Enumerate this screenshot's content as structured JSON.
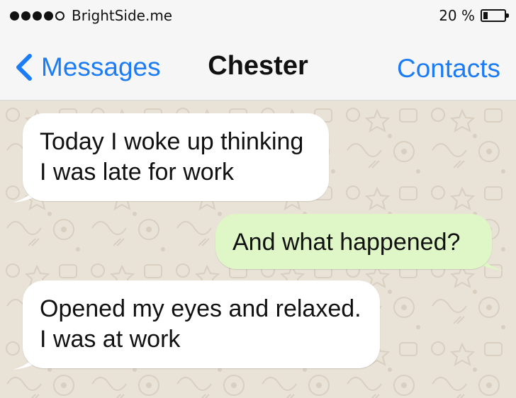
{
  "status_bar": {
    "signal_bars": 5,
    "signal_filled": 4,
    "carrier": "BrightSide.me",
    "battery_text": "20 %",
    "battery_level": 0.2
  },
  "nav": {
    "back_label": "Messages",
    "title": "Chester",
    "right_label": "Contacts",
    "accent_color": "#1b7cf5"
  },
  "messages": [
    {
      "direction": "incoming",
      "lines": [
        "Today I woke up thinking",
        "I was late for work"
      ]
    },
    {
      "direction": "outgoing",
      "lines": [
        "And what happened?"
      ]
    },
    {
      "direction": "incoming",
      "lines": [
        "Opened my eyes and relaxed.",
        "I was at work"
      ]
    }
  ],
  "colors": {
    "incoming_bubble": "#ffffff",
    "outgoing_bubble": "#dff7c6",
    "chat_background": "#e9e2d6"
  }
}
